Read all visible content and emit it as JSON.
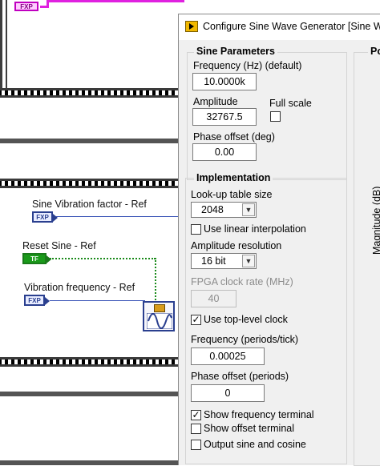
{
  "diagram": {
    "controls": [
      {
        "label": "Sine Vibration factor - Ref",
        "terminal": "FXP"
      },
      {
        "label": "Reset Sine - Ref",
        "terminal": "TF"
      },
      {
        "label": "Vibration frequency - Ref",
        "terminal": "FXP"
      }
    ],
    "top_terminal": "FXP"
  },
  "dialog": {
    "title": "Configure Sine Wave Generator [Sine Wa",
    "sine_parameters": {
      "legend": "Sine Parameters",
      "frequency_label": "Frequency (Hz) (default)",
      "frequency_value": "10.0000k",
      "amplitude_label": "Amplitude",
      "amplitude_value": "32767.5",
      "full_scale_label": "Full scale",
      "full_scale_checked": false,
      "phase_offset_label": "Phase offset (deg)",
      "phase_offset_value": "0.00"
    },
    "implementation": {
      "legend": "Implementation",
      "lut_size_label": "Look-up table size",
      "lut_size_value": "2048",
      "linear_interp_label": "Use linear interpolation",
      "linear_interp_checked": false,
      "amp_res_label": "Amplitude resolution",
      "amp_res_value": "16 bit",
      "fpga_clock_label": "FPGA clock rate (MHz)",
      "fpga_clock_value": "40",
      "top_level_clock_label": "Use top-level clock",
      "top_level_clock_checked": true,
      "freq_periods_label": "Frequency (periods/tick)",
      "freq_periods_value": "0.00025",
      "phase_periods_label": "Phase offset (periods)",
      "phase_periods_value": "0",
      "show_freq_label": "Show frequency terminal",
      "show_freq_checked": true,
      "show_offset_label": "Show offset terminal",
      "show_offset_checked": false,
      "output_sincos_label": "Output sine and cosine",
      "output_sincos_checked": false
    },
    "right_panel": {
      "legend": "Po",
      "axis_label": "Magnitude (dB)"
    },
    "check_mark": "✓"
  },
  "colors": {
    "dialog_bg": "#f0f0f0",
    "fxp_terminal": "#2a3f8f",
    "bool_terminal": "#1a9a1a",
    "pink_wire": "#e020e0"
  }
}
